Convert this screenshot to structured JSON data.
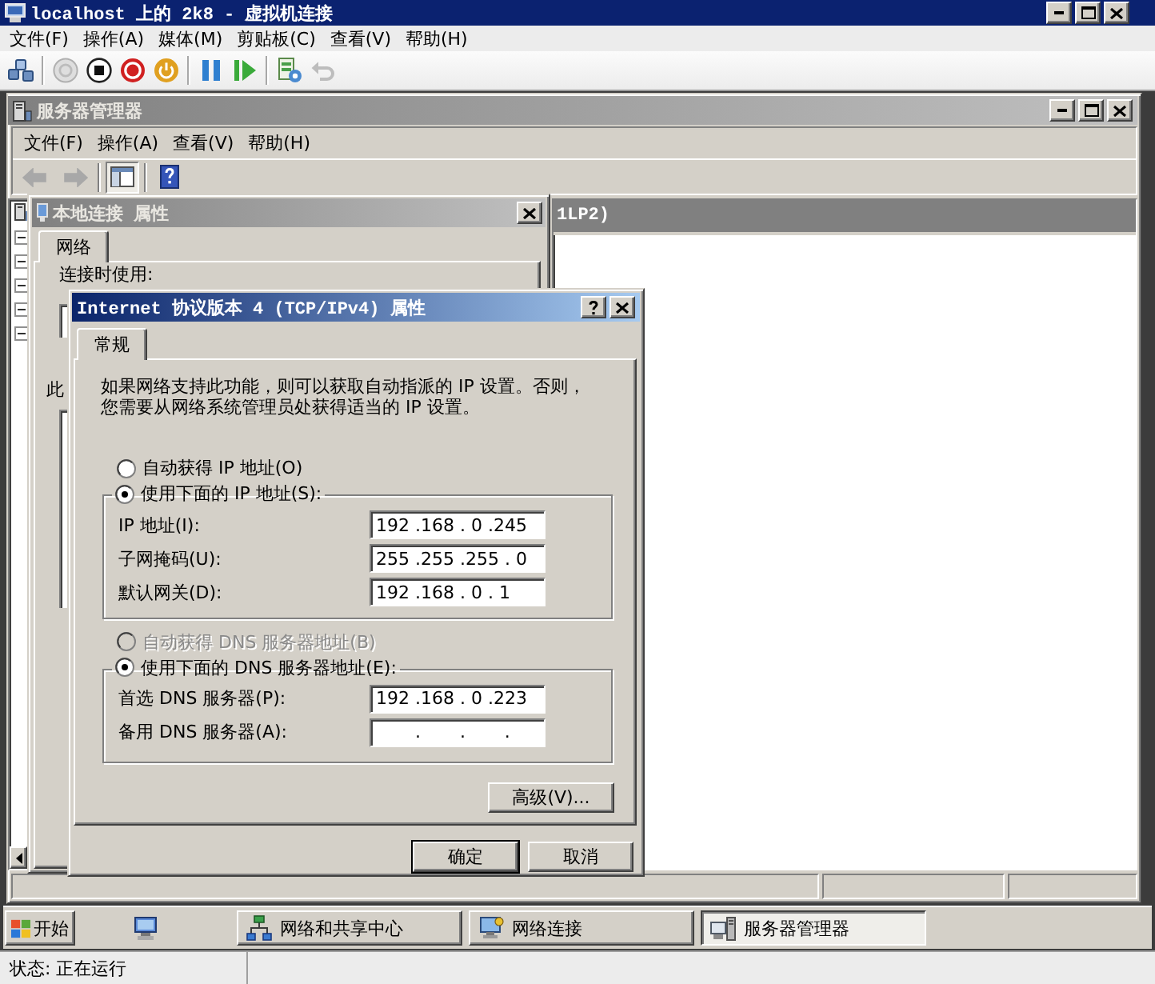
{
  "vm_window": {
    "title": "localhost 上的 2k8 - 虚拟机连接",
    "active": true,
    "controls": [
      {
        "kind": "minimize"
      },
      {
        "kind": "maximize"
      },
      {
        "kind": "close"
      }
    ],
    "menu": [
      "文件(F)",
      "操作(A)",
      "媒体(M)",
      "剪贴板(C)",
      "查看(V)",
      "帮助(H)"
    ],
    "toolbar": [
      {
        "items": [
          {
            "kind": "keys",
            "disabled": false
          }
        ]
      },
      {
        "items": [
          {
            "kind": "start",
            "disabled": true
          },
          {
            "kind": "turn_off",
            "disabled": false
          },
          {
            "kind": "shut_down",
            "disabled": false
          },
          {
            "kind": "save",
            "disabled": false
          }
        ]
      },
      {
        "items": [
          {
            "kind": "pause",
            "disabled": false
          },
          {
            "kind": "resume",
            "disabled": false
          }
        ]
      },
      {
        "items": [
          {
            "kind": "snapshot",
            "disabled": false
          },
          {
            "kind": "revert",
            "disabled": true
          }
        ]
      }
    ]
  },
  "server_manager": {
    "title": "服务器管理器",
    "active": false,
    "controls": [
      {
        "kind": "minimize"
      },
      {
        "kind": "maximize"
      },
      {
        "kind": "close"
      }
    ],
    "menu": [
      "文件(F)",
      "操作(A)",
      "查看(V)",
      "帮助(H)"
    ],
    "toolbar": [
      {
        "items": [
          {
            "kind": "back",
            "disabled": true,
            "pressed": false
          },
          {
            "kind": "forward",
            "disabled": true,
            "pressed": false
          }
        ]
      },
      {
        "items": [
          {
            "kind": "tree_toggle",
            "disabled": false,
            "pressed": true
          }
        ]
      },
      {
        "items": [
          {
            "kind": "help",
            "disabled": false,
            "pressed": false
          }
        ]
      }
    ],
    "tree_nodes": [
      {
        "expanded": true
      },
      {
        "expanded": true
      },
      {
        "expanded": true
      },
      {
        "expanded": true
      },
      {
        "expanded": true
      }
    ],
    "details_header": "1LP2)"
  },
  "properties_dialog": {
    "title": "本地连接 属性",
    "active": false,
    "controls": [
      {
        "kind": "close"
      }
    ],
    "tabs": [
      {
        "label": "网络",
        "selected": true
      }
    ],
    "connect_using": "连接时使用:",
    "list_label": "此"
  },
  "ipv4_dialog": {
    "title": "Internet 协议版本 4 (TCP/IPv4) 属性",
    "active": true,
    "controls": [
      {
        "kind": "help"
      },
      {
        "kind": "close"
      }
    ],
    "tabs": [
      {
        "label": "常规",
        "selected": true
      }
    ],
    "description": "如果网络支持此功能，则可以获取自动指派的 IP 设置。否则，您需要从网络系统管理员处获得适当的 IP 设置。",
    "ip": {
      "auto": {
        "label": "自动获得 IP 地址(O)",
        "selected": false,
        "disabled": false
      },
      "manual": {
        "label": "使用下面的 IP 地址(S):",
        "selected": true,
        "disabled": false
      },
      "fields": [
        {
          "label": "IP 地址(I):",
          "value": "192 .168 . 0 .245"
        },
        {
          "label": "子网掩码(U):",
          "value": "255 .255 .255 . 0"
        },
        {
          "label": "默认网关(D):",
          "value": "192 .168 . 0 . 1"
        }
      ]
    },
    "dns": {
      "auto": {
        "label": "自动获得 DNS 服务器地址(B)",
        "selected": false,
        "disabled": true
      },
      "manual": {
        "label": "使用下面的 DNS 服务器地址(E):",
        "selected": true,
        "disabled": false
      },
      "fields": [
        {
          "label": "首选 DNS 服务器(P):",
          "value": "192 .168 . 0 .223"
        },
        {
          "label": "备用 DNS 服务器(A):",
          "value": "       .       .       ."
        }
      ]
    },
    "advanced_button": "高级(V)...",
    "buttons": [
      {
        "label": "确定",
        "default": true
      },
      {
        "label": "取消",
        "default": false
      }
    ]
  },
  "taskbar": {
    "start": "开始",
    "quick_launch": [
      {
        "kind": "computer"
      }
    ],
    "tasks": [
      {
        "label": "网络和共享中心",
        "kind": "network_center",
        "selected": false
      },
      {
        "label": "网络连接",
        "kind": "network_connections",
        "selected": false
      },
      {
        "label": "服务器管理器",
        "kind": "server_manager",
        "selected": true
      }
    ]
  },
  "status_bar": {
    "text": "状态: 正在运行"
  }
}
